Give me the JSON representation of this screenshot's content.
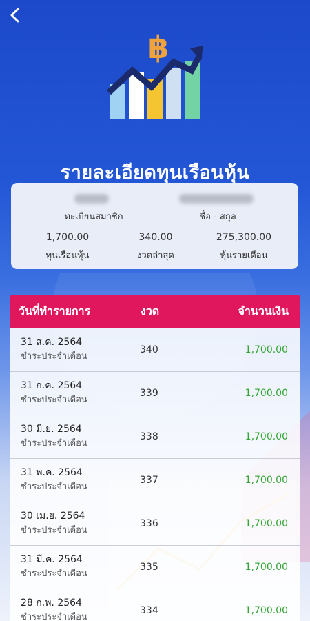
{
  "header": {
    "back_icon": "chevron-left-icon"
  },
  "hero": {
    "icon": "bitcoin-growth-chart-icon",
    "symbol": "฿"
  },
  "title": "รายละเอียดทุนเรือนหุ้น",
  "member": {
    "member_id_label": "ทะเบียนสมาชิก",
    "name_label": "ชื่อ - สกุล"
  },
  "summary": [
    {
      "value": "1,700.00",
      "label": "ทุนเรือนหุ้น"
    },
    {
      "value": "340.00",
      "label": "งวดล่าสุด"
    },
    {
      "value": "275,300.00",
      "label": "หุ้นรายเดือน"
    }
  ],
  "table": {
    "headers": {
      "date": "วันที่ทำรายการ",
      "period": "งวด",
      "amount": "จำนวนเงิน"
    },
    "rows": [
      {
        "date": "31 ส.ค. 2564",
        "desc": "ชำระประจำเดือน",
        "period": "340",
        "amount": "1,700.00"
      },
      {
        "date": "31 ก.ค. 2564",
        "desc": "ชำระประจำเดือน",
        "period": "339",
        "amount": "1,700.00"
      },
      {
        "date": "30 มิ.ย. 2564",
        "desc": "ชำระประจำเดือน",
        "period": "338",
        "amount": "1,700.00"
      },
      {
        "date": "31 พ.ค. 2564",
        "desc": "ชำระประจำเดือน",
        "period": "337",
        "amount": "1,700.00"
      },
      {
        "date": "30 เม.ย. 2564",
        "desc": "ชำระประจำเดือน",
        "period": "336",
        "amount": "1,700.00"
      },
      {
        "date": "31 มี.ค. 2564",
        "desc": "ชำระประจำเดือน",
        "period": "335",
        "amount": "1,700.00"
      },
      {
        "date": "28 ก.พ. 2564",
        "desc": "ชำระประจำเดือน",
        "period": "334",
        "amount": "1,700.00"
      }
    ]
  },
  "colors": {
    "header_bg": "#e0175c",
    "amount_text": "#33a534",
    "background": "#1c49c9",
    "icon_navy": "#1b2a6b",
    "icon_orange": "#f0a23c"
  }
}
